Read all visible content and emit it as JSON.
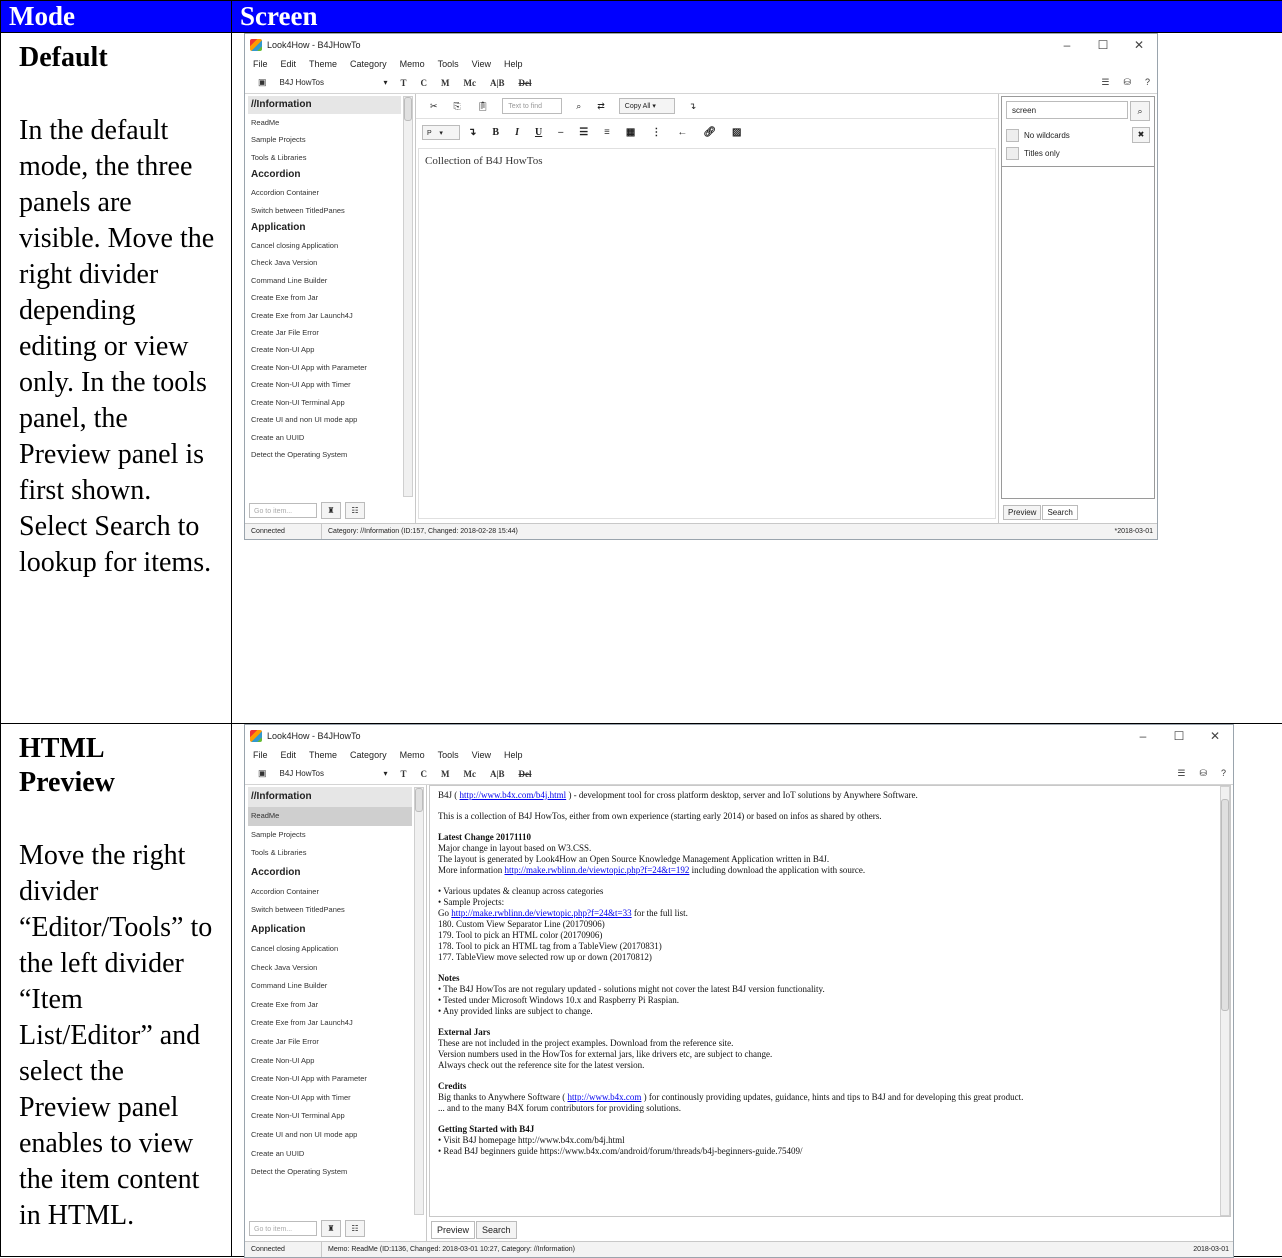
{
  "header": {
    "mode": "Mode",
    "screen": "Screen"
  },
  "rows": [
    {
      "mode_lines": [
        "Default"
      ],
      "description": "In the default mode, the three panels are visible. Move the right divider depending editing or view only. In the tools panel, the Preview panel is first shown. Select Search to lookup for items."
    },
    {
      "mode_lines": [
        "HTML",
        "Preview"
      ],
      "description": "Move the right divider “Editor/Tools” to the left divider “Item List/Editor” and select the Preview panel enables to view the item content in HTML."
    }
  ],
  "app": {
    "title": "Look4How - B4JHowTo",
    "menus": [
      "File",
      "Edit",
      "Theme",
      "Category",
      "Memo",
      "Tools",
      "View",
      "Help"
    ],
    "project": "B4J HowTos",
    "toolbar_letters": [
      "T",
      "C",
      "M",
      "Mc",
      "A|B"
    ],
    "toolbar_strike": "Del",
    "list": [
      {
        "t": "cat",
        "label": "//Information"
      },
      {
        "t": "it",
        "label": "ReadMe"
      },
      {
        "t": "it",
        "label": "Sample Projects"
      },
      {
        "t": "it",
        "label": "Tools & Libraries"
      },
      {
        "t": "cat",
        "label": "Accordion"
      },
      {
        "t": "it",
        "label": "Accordion Container"
      },
      {
        "t": "it",
        "label": "Switch between TitledPanes"
      },
      {
        "t": "cat",
        "label": "Application"
      },
      {
        "t": "it",
        "label": "Cancel closing Application"
      },
      {
        "t": "it",
        "label": "Check Java Version"
      },
      {
        "t": "it",
        "label": "Command Line Builder"
      },
      {
        "t": "it",
        "label": "Create Exe from Jar"
      },
      {
        "t": "it",
        "label": "Create Exe from Jar Launch4J"
      },
      {
        "t": "it",
        "label": "Create Jar File Error"
      },
      {
        "t": "it",
        "label": "Create Non-UI App"
      },
      {
        "t": "it",
        "label": "Create Non-UI App with Parameter"
      },
      {
        "t": "it",
        "label": "Create Non-UI App with Timer"
      },
      {
        "t": "it",
        "label": "Create Non-UI Terminal App"
      },
      {
        "t": "it",
        "label": "Create UI and non UI mode app"
      },
      {
        "t": "it",
        "label": "Create an UUID"
      },
      {
        "t": "it",
        "label": "Detect the Operating System"
      }
    ],
    "goto_placeholder": "Go to item...",
    "find_placeholder": "Text to find",
    "copy_all": "Copy All",
    "para_style": "P",
    "editor_text": "Collection of B4J HowTos",
    "search_value": "screen",
    "opt_no_wildcards": "No wildcards",
    "opt_titles_only": "Titles only",
    "tab_preview": "Preview",
    "tab_search": "Search",
    "status_connected": "Connected",
    "status1": "Category: //Information (ID:157, Changed: 2018-02-28 15:44)",
    "status1_date": "*2018-03-01",
    "status2": "Memo: ReadMe (ID:1136, Changed: 2018-03-01 10:27, Category: //Information)",
    "status2_date": "2018-03-01"
  },
  "preview": {
    "l1a": "B4J ( ",
    "l1link": "http://www.b4x.com/b4j.html",
    "l1b": " ) - development tool for cross platform desktop, server and IoT solutions by Anywhere Software.",
    "l2": "This is a collection of B4J HowTos, either from own experience (starting early 2014) or based on infos as shared by others.",
    "latest_h": "Latest Change 20171110",
    "latest_1": "Major change in layout based on W3.CSS.",
    "latest_2": "The layout is generated by Look4How an Open Source Knowledge Management Application written in B4J.",
    "latest_3a": "More information ",
    "latest_3link": "http://make.rwblinn.de/viewtopic.php?f=24&t=192",
    "latest_3b": " including download the application with source.",
    "upd_1": "• Various updates & cleanup across categories",
    "upd_2": "• Sample Projects:",
    "upd_3a": "Go ",
    "upd_3link": "http://make.rwblinn.de/viewtopic.php?f=24&t=33",
    "upd_3b": " for the full list.",
    "upd_4": "180. Custom View Separator Line (20170906)",
    "upd_5": "179. Tool to pick an HTML color (20170906)",
    "upd_6": "178. Tool to pick an HTML tag from a TableView (20170831)",
    "upd_7": "177. TableView move selected row up or down (20170812)",
    "notes_h": "Notes",
    "notes_1": "• The B4J HowTos are not regulary updated - solutions might not cover the latest B4J version functionality.",
    "notes_2": "• Tested under Microsoft Windows 10.x and Raspberry Pi Raspian.",
    "notes_3": "• Any provided links are subject to change.",
    "ext_h": "External Jars",
    "ext_1": "These are not included in the project examples. Download from the reference site.",
    "ext_2": "Version numbers used in the HowTos for external jars, like drivers etc, are subject to change.",
    "ext_3": "Always check out the reference site for the latest version.",
    "cred_h": "Credits",
    "cred_1a": "Big thanks to Anywhere Software ( ",
    "cred_1link": "http://www.b4x.com",
    "cred_1b": " ) for continously providing updates, guidance, hints and tips to B4J and for developing this great product.",
    "cred_2": "... and to the many B4X forum contributors for providing solutions.",
    "gs_h": "Getting Started with B4J",
    "gs_1": "• Visit B4J homepage http://www.b4x.com/b4j.html",
    "gs_2": "• Read B4J beginners guide https://www.b4x.com/android/forum/threads/b4j-beginners-guide.75409/"
  }
}
